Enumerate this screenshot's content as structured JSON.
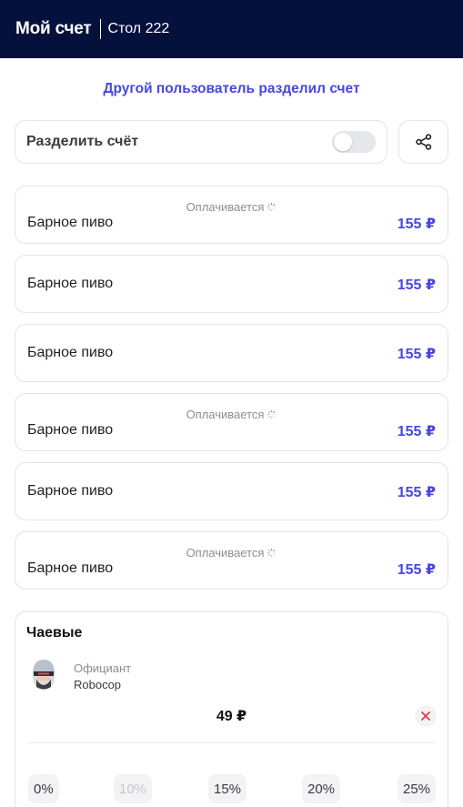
{
  "header": {
    "title": "Мой счет",
    "table": "Стол 222"
  },
  "notice": "Другой пользователь разделил счет",
  "split": {
    "label": "Разделить счёт",
    "enabled": false
  },
  "items": [
    {
      "name": "Барное пиво",
      "price": "155 ₽",
      "status": "Оплачивается"
    },
    {
      "name": "Барное пиво",
      "price": "155 ₽",
      "status": ""
    },
    {
      "name": "Барное пиво",
      "price": "155 ₽",
      "status": ""
    },
    {
      "name": "Барное пиво",
      "price": "155 ₽",
      "status": "Оплачивается"
    },
    {
      "name": "Барное пиво",
      "price": "155 ₽",
      "status": ""
    },
    {
      "name": "Барное пиво",
      "price": "155 ₽",
      "status": "Оплачивается"
    }
  ],
  "tips": {
    "title": "Чаевые",
    "role": "Официант",
    "waiter": "Robocop",
    "amount": "49 ₽",
    "options": [
      {
        "label": "0%",
        "disabled": false
      },
      {
        "label": "10%",
        "disabled": true
      },
      {
        "label": "15%",
        "disabled": false
      },
      {
        "label": "20%",
        "disabled": false
      },
      {
        "label": "25%",
        "disabled": false
      }
    ]
  },
  "colors": {
    "header_bg": "#04113d",
    "accent": "#4747e0",
    "danger": "#e53a4e"
  }
}
